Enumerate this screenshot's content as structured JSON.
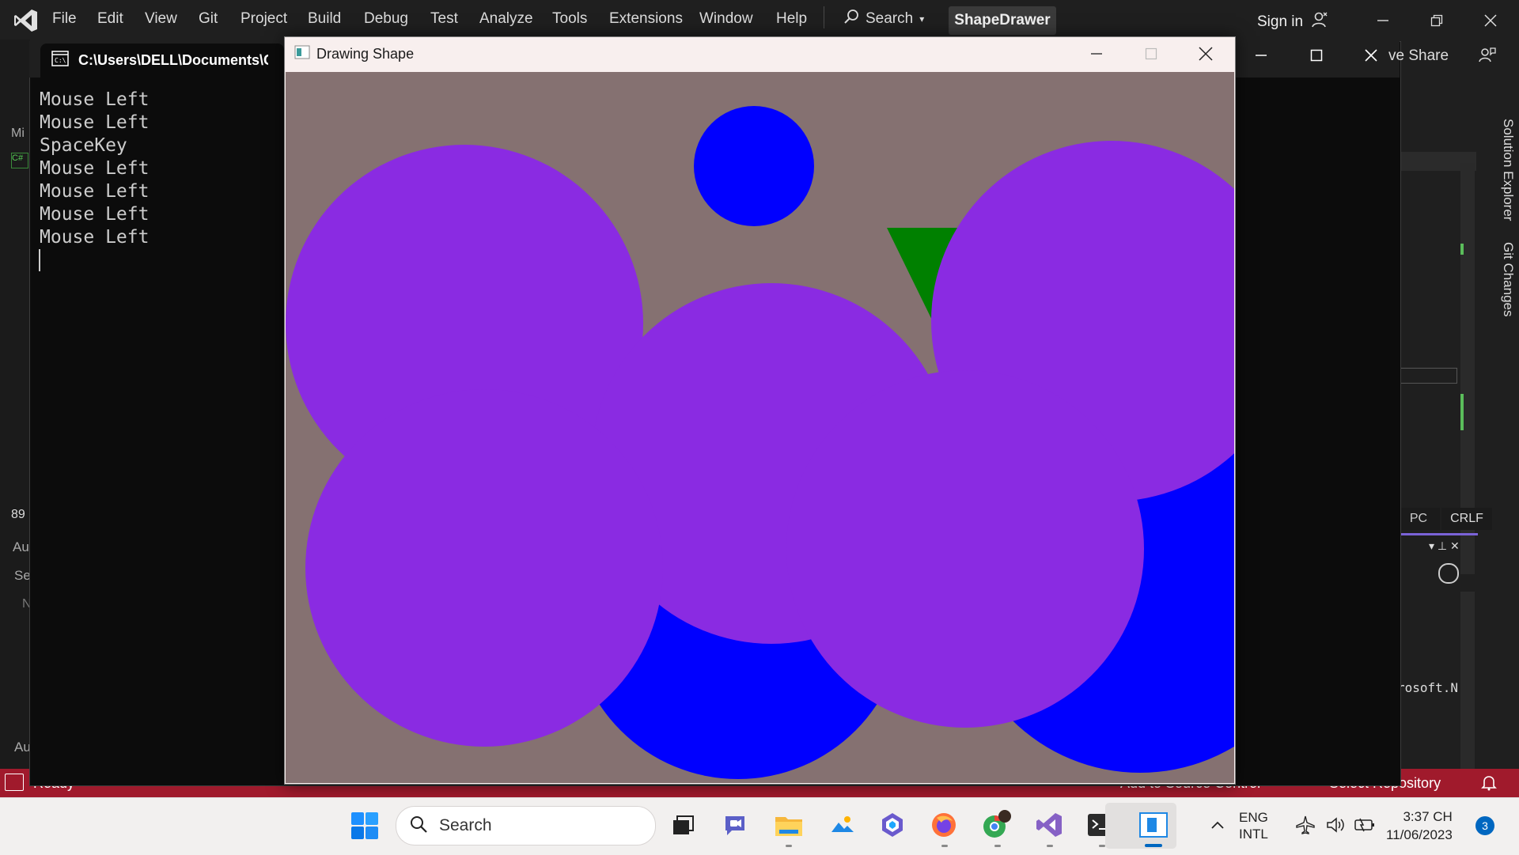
{
  "vs": {
    "menu": [
      "File",
      "Edit",
      "View",
      "Git",
      "Project",
      "Build",
      "Debug",
      "Test",
      "Analyze",
      "Tools",
      "Extensions",
      "Window",
      "Help"
    ],
    "search_label": "Search",
    "project_name": "ShapeDrawer",
    "sign_in": "Sign in",
    "live_share": "ve Share",
    "side_tabs": [
      "Solution Explorer",
      "Git Changes"
    ],
    "status": {
      "left": "Ready",
      "add_source": "Add to Source Control",
      "select_repo": "Select Repository"
    },
    "fragments": {
      "line_ending": "CRLF",
      "enc": "PC",
      "line_no": "89",
      "ms": "Mi",
      "au": "Au",
      "se": "Se",
      "au2": "Au",
      "n": "N",
      "microsoft": "rosoft.N"
    },
    "accent": "#a01a2c"
  },
  "console": {
    "tab_title": "C:\\Users\\DELL\\Documents\\CC",
    "lines": [
      "Mouse Left",
      "Mouse Left",
      "SpaceKey",
      "Mouse Left",
      "Mouse Left",
      "Mouse Left",
      "Mouse Left"
    ]
  },
  "drawing_window": {
    "title": "Drawing Shape",
    "background": "#857171",
    "shapes": [
      {
        "kind": "circle",
        "color": "#0000ff"
      },
      {
        "kind": "triangle",
        "color": "#008000"
      },
      {
        "kind": "circle",
        "color": "#0000ff"
      },
      {
        "kind": "circle",
        "color": "#0000ff"
      },
      {
        "kind": "circle",
        "color": "#8a2be2"
      },
      {
        "kind": "circle",
        "color": "#8a2be2"
      },
      {
        "kind": "circle",
        "color": "#8a2be2"
      },
      {
        "kind": "circle",
        "color": "#8a2be2"
      },
      {
        "kind": "circle",
        "color": "#8a2be2"
      }
    ]
  },
  "taskbar": {
    "search_label": "Search",
    "lang_top": "ENG",
    "lang_bottom": "INTL",
    "time": "3:37 CH",
    "date": "11/06/2023",
    "notifications": "3"
  }
}
